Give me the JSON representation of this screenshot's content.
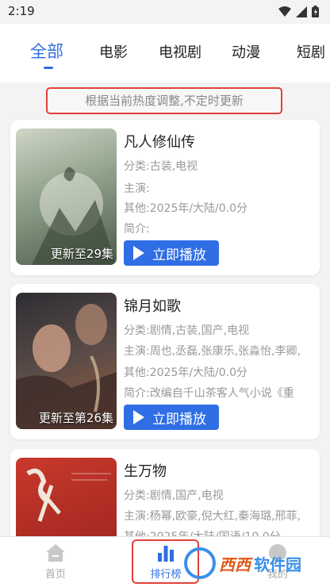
{
  "status": {
    "time": "2:19"
  },
  "tabs": [
    {
      "label": "全部",
      "active": true
    },
    {
      "label": "电影"
    },
    {
      "label": "电视剧"
    },
    {
      "label": "动漫"
    },
    {
      "label": "短剧"
    }
  ],
  "notice": "根据当前热度调整,不定时更新",
  "cards": [
    {
      "title": "凡人修仙传",
      "category": "分类:古装,电视",
      "cast": "主演:",
      "other": "其他:2025年/大陆/0.0分",
      "intro": "简介:",
      "poster_caption": "更新至29集",
      "play_label": "立即播放",
      "poster_colors": [
        "#b9c3b0",
        "#5d6f59"
      ]
    },
    {
      "title": "锦月如歌",
      "category": "分类:剧情,古装,国产,电视",
      "cast": "主演:周也,丞磊,张康乐,张淼怡,李卿,",
      "other": "其他:2025年/大陆/0.0分",
      "intro": "简介:改编自千山茶客人气小说《重",
      "poster_caption": "更新至第26集",
      "play_label": "立即播放",
      "poster_colors": [
        "#3b3a40",
        "#a05a3a"
      ]
    },
    {
      "title": "生万物",
      "category": "分类:剧情,国产,电视",
      "cast": "主演:杨幂,欧豪,倪大红,秦海璐,邢菲,",
      "other": "其他:2025年/大陆/国语/10.0分",
      "intro": "",
      "poster_caption": "",
      "play_label": "",
      "poster_colors": [
        "#c2352b",
        "#8d1f1a"
      ]
    }
  ],
  "bottom_nav": [
    {
      "label": "首页",
      "icon": "home-icon"
    },
    {
      "label": "排行榜",
      "icon": "ranking-icon",
      "active": true
    },
    {
      "label": "我的",
      "icon": "user-icon"
    }
  ],
  "watermark": {
    "part1": "西西",
    "part2": "软件园"
  },
  "colors": {
    "accent": "#2f6ee5",
    "highlight": "#e0423a"
  }
}
